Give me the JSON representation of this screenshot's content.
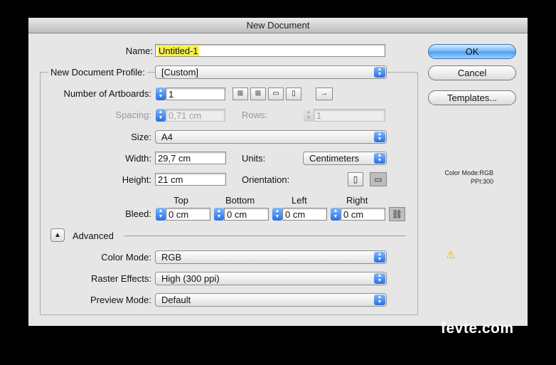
{
  "dialog": {
    "title": "New Document"
  },
  "name": {
    "label": "Name:",
    "value": "Untitled-1"
  },
  "profile": {
    "label": "New Document Profile:",
    "value": "[Custom]"
  },
  "artboards": {
    "label": "Number of Artboards:",
    "value": "1"
  },
  "spacing": {
    "label": "Spacing:",
    "value": "0,71 cm",
    "rows_label": "Rows:",
    "rows_value": "1"
  },
  "size": {
    "label": "Size:",
    "value": "A4"
  },
  "width": {
    "label": "Width:",
    "value": "29,7 cm"
  },
  "units": {
    "label": "Units:",
    "value": "Centimeters"
  },
  "height": {
    "label": "Height:",
    "value": "21 cm"
  },
  "orientation": {
    "label": "Orientation:"
  },
  "bleed": {
    "label": "Bleed:",
    "top_label": "Top",
    "bottom_label": "Bottom",
    "left_label": "Left",
    "right_label": "Right",
    "top": "0 cm",
    "bottom": "0 cm",
    "left": "0 cm",
    "right": "0 cm"
  },
  "advanced": {
    "label": "Advanced"
  },
  "color_mode": {
    "label": "Color Mode:",
    "value": "RGB"
  },
  "raster": {
    "label": "Raster Effects:",
    "value": "High (300 ppi)"
  },
  "preview": {
    "label": "Preview Mode:",
    "value": "Default"
  },
  "buttons": {
    "ok": "OK",
    "cancel": "Cancel",
    "templates": "Templates..."
  },
  "info": {
    "color_mode": "Color Mode:RGB",
    "ppi": "PPI:300"
  },
  "watermark": {
    "text": "fevte.com"
  }
}
